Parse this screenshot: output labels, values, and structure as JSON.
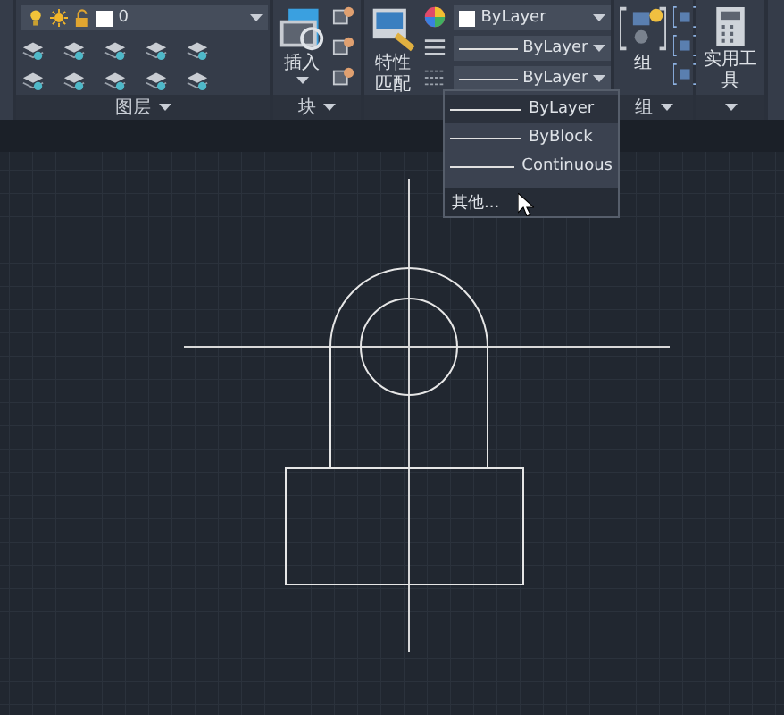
{
  "layer_panel": {
    "current_layer": "0",
    "label": "图层"
  },
  "block_panel": {
    "insert_label": "插入",
    "label": "块"
  },
  "properties_panel": {
    "match_label": "特性匹配",
    "color_control": "ByLayer",
    "linetype": "ByLayer",
    "lineweight": "ByLayer"
  },
  "group_panel": {
    "group_label": "组",
    "label": "组"
  },
  "utilities_panel": {
    "label": "实用工具"
  },
  "linetype_dropdown": {
    "items": [
      {
        "label": "ByLayer",
        "selected": true
      },
      {
        "label": "ByBlock",
        "selected": false
      },
      {
        "label": "Continuous",
        "selected": false
      }
    ],
    "other": "其他..."
  }
}
